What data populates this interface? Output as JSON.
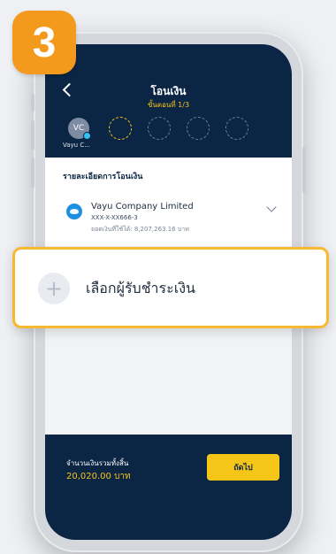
{
  "step_number": "3",
  "header": {
    "title": "โอนเงิน",
    "subtitle": "ขั้นตอนที่ 1/3"
  },
  "payees": {
    "selected": {
      "initials": "VC",
      "name": "Vayu C..."
    }
  },
  "transfer_details": {
    "section_title": "รายละเอียดการโอนเงิน",
    "account_name": "Vayu Company Limited",
    "account_number": "XXX-X-XX666-3",
    "available_balance": "ยอดเงินที่ใช้ได้: 8,207,263.16 บาท"
  },
  "select_recipient": {
    "label": "เลือกผู้รับชำระเงิน",
    "icon": "plus-icon"
  },
  "footer": {
    "total_label": "จำนวนเงินรวมทั้งสิ้น",
    "total_value": "20,020.00 บาท",
    "next_label": "ถัดไป"
  },
  "colors": {
    "navy": "#0b2545",
    "accent_yellow": "#f5c518",
    "badge_orange": "#f39a1d",
    "callout_border": "#f7b932"
  }
}
